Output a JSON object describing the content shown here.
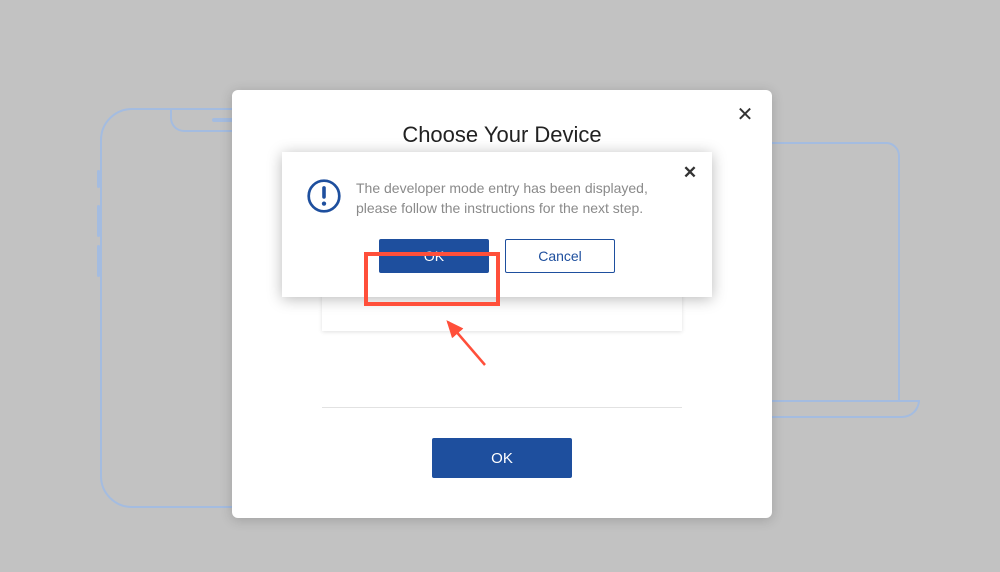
{
  "modal": {
    "title": "Choose Your Device",
    "ok_label": "OK"
  },
  "alert": {
    "message": "The developer mode entry has been displayed, please follow the instructions for the next step.",
    "ok_label": "OK",
    "cancel_label": "Cancel"
  },
  "icons": {
    "close": "✕",
    "caution": "!"
  },
  "colors": {
    "primary": "#1e4f9e",
    "highlight": "#ff4f3a"
  }
}
